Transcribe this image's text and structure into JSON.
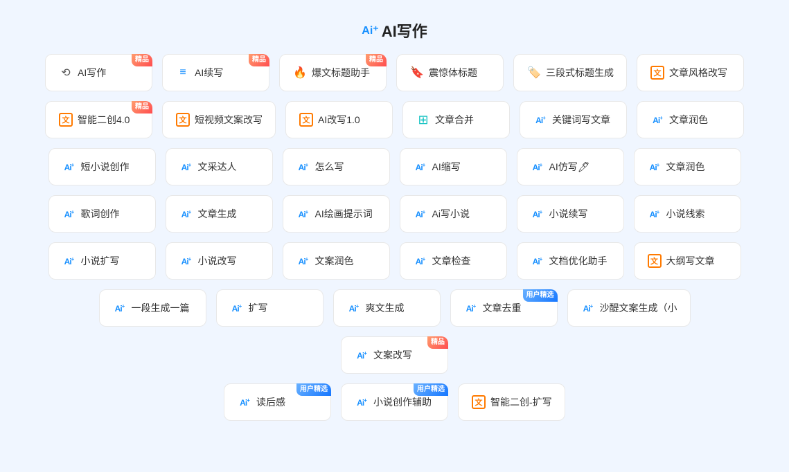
{
  "page": {
    "title": "AI写作",
    "title_icon": "Ai⁺"
  },
  "rows": [
    {
      "items": [
        {
          "id": "ai-write",
          "icon": "🔁",
          "icon_type": "emoji",
          "label": "AI写作",
          "badge": "精品",
          "badge_type": "jingpin"
        },
        {
          "id": "ai-continue",
          "icon": "📝",
          "icon_type": "emoji",
          "label": "AI续写",
          "badge": "精品",
          "badge_type": "jingpin"
        },
        {
          "id": "explosive-title",
          "icon": "🔥",
          "icon_type": "emoji",
          "label": "爆文标题助手",
          "badge": "精品",
          "badge_type": "jingpin"
        },
        {
          "id": "shock-title",
          "icon": "🔖",
          "icon_type": "emoji",
          "label": "震惊体标题",
          "badge": "",
          "badge_type": ""
        },
        {
          "id": "three-title",
          "icon": "🏷️",
          "icon_type": "emoji",
          "label": "三段式标题生成",
          "badge": "",
          "badge_type": ""
        },
        {
          "id": "article-style",
          "icon": "📄",
          "icon_type": "box",
          "label": "文章风格改写",
          "badge": "",
          "badge_type": ""
        }
      ]
    },
    {
      "items": [
        {
          "id": "smart-create",
          "icon": "📄",
          "icon_type": "box",
          "label": "智能二创4.0",
          "badge": "精品",
          "badge_type": "jingpin"
        },
        {
          "id": "short-video",
          "icon": "📄",
          "icon_type": "box",
          "label": "短视频文案改写",
          "badge": "",
          "badge_type": ""
        },
        {
          "id": "ai-rewrite",
          "icon": "📄",
          "icon_type": "box",
          "label": "AI改写1.0",
          "badge": "",
          "badge_type": ""
        },
        {
          "id": "article-merge",
          "icon": "⊞",
          "icon_type": "merge",
          "label": "文章合并",
          "badge": "",
          "badge_type": ""
        },
        {
          "id": "keyword-article",
          "icon": "Ai⁺",
          "icon_type": "ai",
          "label": "关键词写文章",
          "badge": "",
          "badge_type": ""
        },
        {
          "id": "article-polish1",
          "icon": "Ai⁺",
          "icon_type": "ai",
          "label": "文章润色",
          "badge": "",
          "badge_type": ""
        }
      ]
    },
    {
      "items": [
        {
          "id": "short-novel",
          "icon": "Ai⁺",
          "icon_type": "ai",
          "label": "短小说创作",
          "badge": "",
          "badge_type": ""
        },
        {
          "id": "wen-cai",
          "icon": "Ai⁺",
          "icon_type": "ai",
          "label": "文采达人",
          "badge": "",
          "badge_type": ""
        },
        {
          "id": "how-write",
          "icon": "Ai⁺",
          "icon_type": "ai",
          "label": "怎么写",
          "badge": "",
          "badge_type": ""
        },
        {
          "id": "ai-shorten",
          "icon": "Ai⁺",
          "icon_type": "ai",
          "label": "AI缩写",
          "badge": "",
          "badge_type": ""
        },
        {
          "id": "ai-imitate",
          "icon": "Ai⁺",
          "icon_type": "ai",
          "label": "AI仿写🖊",
          "badge": "",
          "badge_type": ""
        },
        {
          "id": "article-polish2",
          "icon": "Ai⁺",
          "icon_type": "ai",
          "label": "文章润色",
          "badge": "",
          "badge_type": ""
        }
      ]
    },
    {
      "items": [
        {
          "id": "lyric-create",
          "icon": "Ai⁺",
          "icon_type": "ai",
          "label": "歌词创作",
          "badge": "",
          "badge_type": ""
        },
        {
          "id": "article-gen",
          "icon": "Ai⁺",
          "icon_type": "ai",
          "label": "文章生成",
          "badge": "",
          "badge_type": ""
        },
        {
          "id": "ai-draw-prompt",
          "icon": "Ai⁺",
          "icon_type": "ai",
          "label": "AI绘画提示词",
          "badge": "",
          "badge_type": ""
        },
        {
          "id": "ai-write-novel",
          "icon": "Ai⁺",
          "icon_type": "ai",
          "label": "Ai写小说",
          "badge": "",
          "badge_type": ""
        },
        {
          "id": "novel-continue",
          "icon": "Ai⁺",
          "icon_type": "ai",
          "label": "小说续写",
          "badge": "",
          "badge_type": ""
        },
        {
          "id": "novel-clues",
          "icon": "Ai⁺",
          "icon_type": "ai",
          "label": "小说线索",
          "badge": "",
          "badge_type": ""
        }
      ]
    },
    {
      "items": [
        {
          "id": "novel-expand",
          "icon": "Ai⁺",
          "icon_type": "ai",
          "label": "小说扩写",
          "badge": "",
          "badge_type": ""
        },
        {
          "id": "novel-rewrite",
          "icon": "Ai⁺",
          "icon_type": "ai",
          "label": "小说改写",
          "badge": "",
          "badge_type": ""
        },
        {
          "id": "copy-polish",
          "icon": "Ai⁺",
          "icon_type": "ai",
          "label": "文案润色",
          "badge": "",
          "badge_type": ""
        },
        {
          "id": "article-check",
          "icon": "Ai⁺",
          "icon_type": "ai",
          "label": "文章检查",
          "badge": "",
          "badge_type": ""
        },
        {
          "id": "doc-optimize",
          "icon": "Ai⁺",
          "icon_type": "ai",
          "label": "文档优化助手",
          "badge": "",
          "badge_type": ""
        },
        {
          "id": "outline-article",
          "icon": "📄",
          "icon_type": "box",
          "label": "大纲写文章",
          "badge": "",
          "badge_type": ""
        }
      ]
    },
    {
      "items": [
        {
          "id": "one-paragraph",
          "icon": "Ai⁺",
          "icon_type": "ai",
          "label": "一段生成一篇",
          "badge": "",
          "badge_type": ""
        },
        {
          "id": "expand-write",
          "icon": "Ai⁺",
          "icon_type": "ai",
          "label": "扩写",
          "badge": "",
          "badge_type": ""
        },
        {
          "id": "爽文-gen",
          "icon": "Ai⁺",
          "icon_type": "ai",
          "label": "爽文生成",
          "badge": "",
          "badge_type": ""
        },
        {
          "id": "article-dedup",
          "icon": "Ai⁺",
          "icon_type": "ai",
          "label": "文章去重",
          "badge": "用户精选",
          "badge_type": "user"
        },
        {
          "id": "sha-li-copy",
          "icon": "Ai⁺",
          "icon_type": "ai",
          "label": "沙醍文案生成（小",
          "badge": "",
          "badge_type": ""
        },
        {
          "id": "copy-rewrite",
          "icon": "Ai⁺",
          "icon_type": "ai",
          "label": "文案改写",
          "badge": "精品",
          "badge_type": "jingpin"
        }
      ]
    },
    {
      "items": [
        {
          "id": "read-feeling",
          "icon": "Ai⁺",
          "icon_type": "ai",
          "label": "读后感",
          "badge": "用户精选",
          "badge_type": "user"
        },
        {
          "id": "novel-assist",
          "icon": "Ai⁺",
          "icon_type": "ai",
          "label": "小说创作辅助",
          "badge": "用户精选",
          "badge_type": "user"
        },
        {
          "id": "smart-create2",
          "icon": "📄",
          "icon_type": "box",
          "label": "智能二创-扩写",
          "badge": "",
          "badge_type": ""
        }
      ]
    }
  ]
}
